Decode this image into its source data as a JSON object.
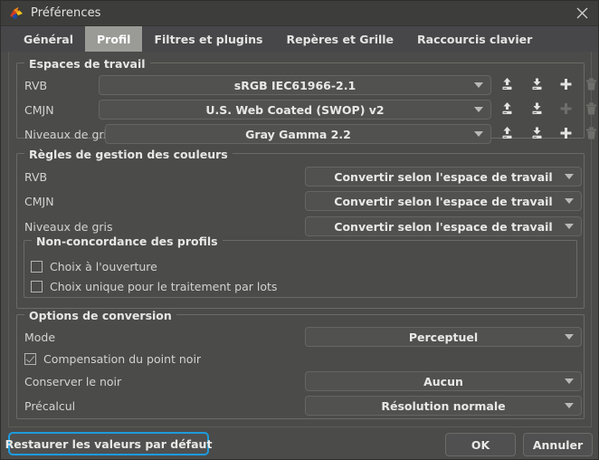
{
  "window": {
    "title": "Préférences",
    "app_icon": "bird-logo-icon",
    "close_icon": "close-icon"
  },
  "tabs": [
    {
      "label": "Général",
      "active": false
    },
    {
      "label": "Profil",
      "active": true
    },
    {
      "label": "Filtres et plugins",
      "active": false
    },
    {
      "label": "Repères et Grille",
      "active": false
    },
    {
      "label": "Raccourcis clavier",
      "active": false
    }
  ],
  "groups": {
    "workspaces": {
      "title": "Espaces de travail",
      "rows": [
        {
          "label": "RVB",
          "value": "sRGB IEC61966-2.1",
          "actions": [
            {
              "icon": "upload-icon",
              "enabled": true
            },
            {
              "icon": "download-icon",
              "enabled": true
            },
            {
              "icon": "plus-icon",
              "enabled": true
            },
            {
              "icon": "trash-icon",
              "enabled": false
            }
          ]
        },
        {
          "label": "CMJN",
          "value": "U.S. Web Coated (SWOP) v2",
          "actions": [
            {
              "icon": "upload-icon",
              "enabled": true
            },
            {
              "icon": "download-icon",
              "enabled": true
            },
            {
              "icon": "plus-icon",
              "enabled": false
            },
            {
              "icon": "trash-icon",
              "enabled": false
            }
          ]
        },
        {
          "label": "Niveaux de gris",
          "value": "Gray Gamma 2.2",
          "actions": [
            {
              "icon": "upload-icon",
              "enabled": true
            },
            {
              "icon": "download-icon",
              "enabled": true
            },
            {
              "icon": "plus-icon",
              "enabled": true
            },
            {
              "icon": "trash-icon",
              "enabled": false
            }
          ]
        }
      ]
    },
    "color_rules": {
      "title": "Règles de gestion des couleurs",
      "rows": [
        {
          "label": "RVB",
          "value": "Convertir selon l'espace de travail"
        },
        {
          "label": "CMJN",
          "value": "Convertir selon l'espace de travail"
        },
        {
          "label": "Niveaux de gris",
          "value": "Convertir selon l'espace de travail"
        }
      ]
    },
    "mismatch": {
      "title": "Non-concordance des profils",
      "checkboxes": [
        {
          "label": "Choix à l'ouverture",
          "checked": false
        },
        {
          "label": "Choix unique pour le traitement par lots",
          "checked": false
        }
      ]
    },
    "conversion": {
      "title": "Options de conversion",
      "mode_label": "Mode",
      "mode_value": "Perceptuel",
      "blackpoint": {
        "label": "Compensation du point noir",
        "checked": true
      },
      "keep_black_label": "Conserver le noir",
      "keep_black_value": "Aucun",
      "precompute_label": "Précalcul",
      "precompute_value": "Résolution normale"
    }
  },
  "footer": {
    "restore_label": "Restaurer les valeurs par défaut",
    "ok_label": "OK",
    "cancel_label": "Annuler"
  },
  "colors": {
    "dialog_bg": "#4b4b49",
    "titlebar_bg": "#3d3d3b",
    "tabbar_bg": "#47474a",
    "active_tab_bg": "#9a9a96",
    "focus_blue": "#1e9bdc",
    "text": "#d6d6d4"
  }
}
